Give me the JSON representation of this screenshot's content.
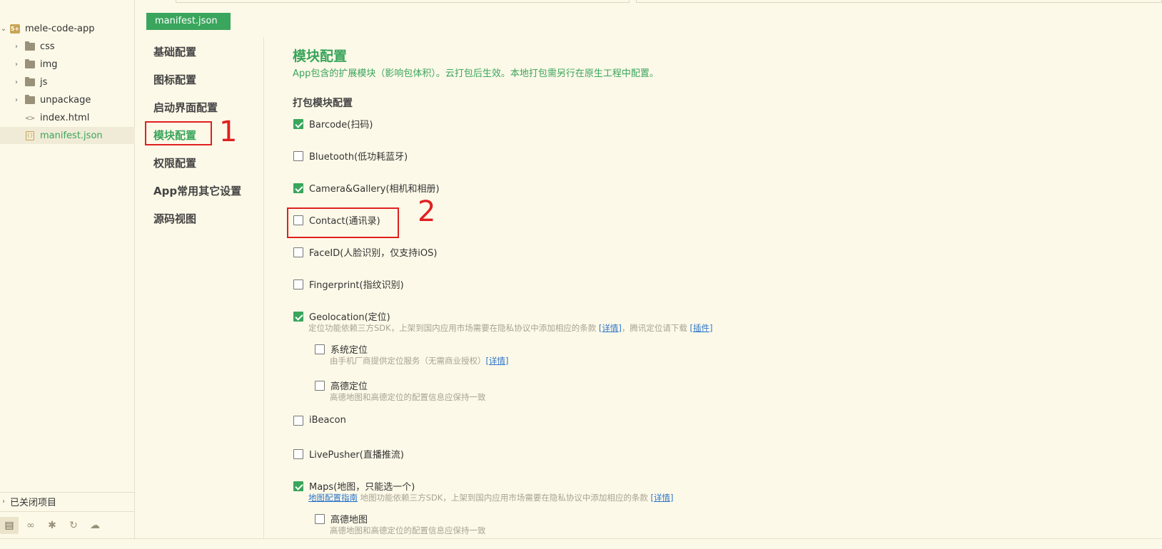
{
  "sidebar": {
    "project": "mele-code-app",
    "items": [
      {
        "label": "css",
        "type": "folder"
      },
      {
        "label": "img",
        "type": "folder"
      },
      {
        "label": "js",
        "type": "folder"
      },
      {
        "label": "unpackage",
        "type": "folder"
      },
      {
        "label": "index.html",
        "type": "file"
      },
      {
        "label": "manifest.json",
        "type": "json",
        "selected": true
      }
    ],
    "closed_projects": "已关闭项目",
    "toolbar_icons": [
      "project-icon",
      "binoculars-icon",
      "bug-icon",
      "sync-icon",
      "cloud-icon"
    ]
  },
  "tab": {
    "label": "manifest.json"
  },
  "nav": {
    "items": [
      "基础配置",
      "图标配置",
      "启动界面配置",
      "模块配置",
      "权限配置",
      "App常用其它设置",
      "源码视图"
    ],
    "active": "模块配置"
  },
  "annotations": {
    "n1": "1",
    "n2": "2"
  },
  "content": {
    "title": "模块配置",
    "desc": "App包含的扩展模块（影响包体积）。云打包后生效。本地打包需另行在原生工程中配置。",
    "subtitle": "打包模块配置",
    "modules": [
      {
        "label": "Barcode(扫码)",
        "checked": true
      },
      {
        "label": "Bluetooth(低功耗蓝牙)",
        "checked": false
      },
      {
        "label": "Camera&Gallery(相机和相册)",
        "checked": true
      },
      {
        "label": "Contact(通讯录)",
        "checked": false
      },
      {
        "label": "FaceID(人脸识别，仅支持iOS)",
        "checked": false
      },
      {
        "label": "Fingerprint(指纹识别)",
        "checked": false
      },
      {
        "label": "Geolocation(定位)",
        "checked": true
      },
      {
        "label": "iBeacon",
        "checked": false
      },
      {
        "label": "LivePusher(直播推流)",
        "checked": false
      },
      {
        "label": "Maps(地图，只能选一个)",
        "checked": true
      }
    ],
    "geo_note": {
      "text1": "定位功能依赖三方SDK，上架到国内应用市场需要在隐私协议中添加相应的条款 ",
      "link1": "[详情]",
      "text2": "，腾讯定位请下载 ",
      "link2": "[插件]"
    },
    "geo_sub": [
      {
        "label": "系统定位",
        "checked": false,
        "note": "由手机厂商提供定位服务（无需商业授权）",
        "link": "[详情]"
      },
      {
        "label": "高德定位",
        "checked": false,
        "note": "高德地图和高德定位的配置信息应保持一致"
      }
    ],
    "maps_note": {
      "link1": "地图配置指南",
      "text1": " 地图功能依赖三方SDK，上架到国内应用市场需要在隐私协议中添加相应的条款 ",
      "link2": "[详情]"
    },
    "maps_sub": [
      {
        "label": "高德地图",
        "checked": false,
        "note": "高德地图和高德定位的配置信息应保持一致"
      }
    ]
  },
  "colors": {
    "accent": "#3aa55c",
    "annotation": "#e02020",
    "background": "#fdf9e8",
    "link": "#2c74c9"
  }
}
